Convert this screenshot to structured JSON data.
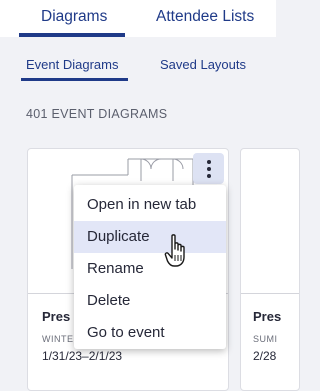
{
  "top_tabs": [
    {
      "label": "Diagrams",
      "active": true
    },
    {
      "label": "Attendee Lists",
      "active": false
    }
  ],
  "sub_tabs": [
    {
      "label": "Event Diagrams",
      "active": true
    },
    {
      "label": "Saved Layouts",
      "active": false
    }
  ],
  "count_label": "401 EVENT DIAGRAMS",
  "cards": [
    {
      "name": "Pres",
      "season": "WINTE",
      "dates": "1/31/23–2/1/23"
    },
    {
      "name": "Pres",
      "season": "SUMI",
      "dates": "2/28"
    }
  ],
  "context_menu": {
    "items": [
      "Open in new tab",
      "Duplicate",
      "Rename",
      "Delete",
      "Go to event"
    ],
    "hovered": "Duplicate"
  },
  "colors": {
    "accent": "#1f3a88",
    "background": "#f1f2f6",
    "hover": "#e2e6f7"
  },
  "icons": [
    "more-vertical-icon",
    "hand-pointer-cursor-icon"
  ]
}
